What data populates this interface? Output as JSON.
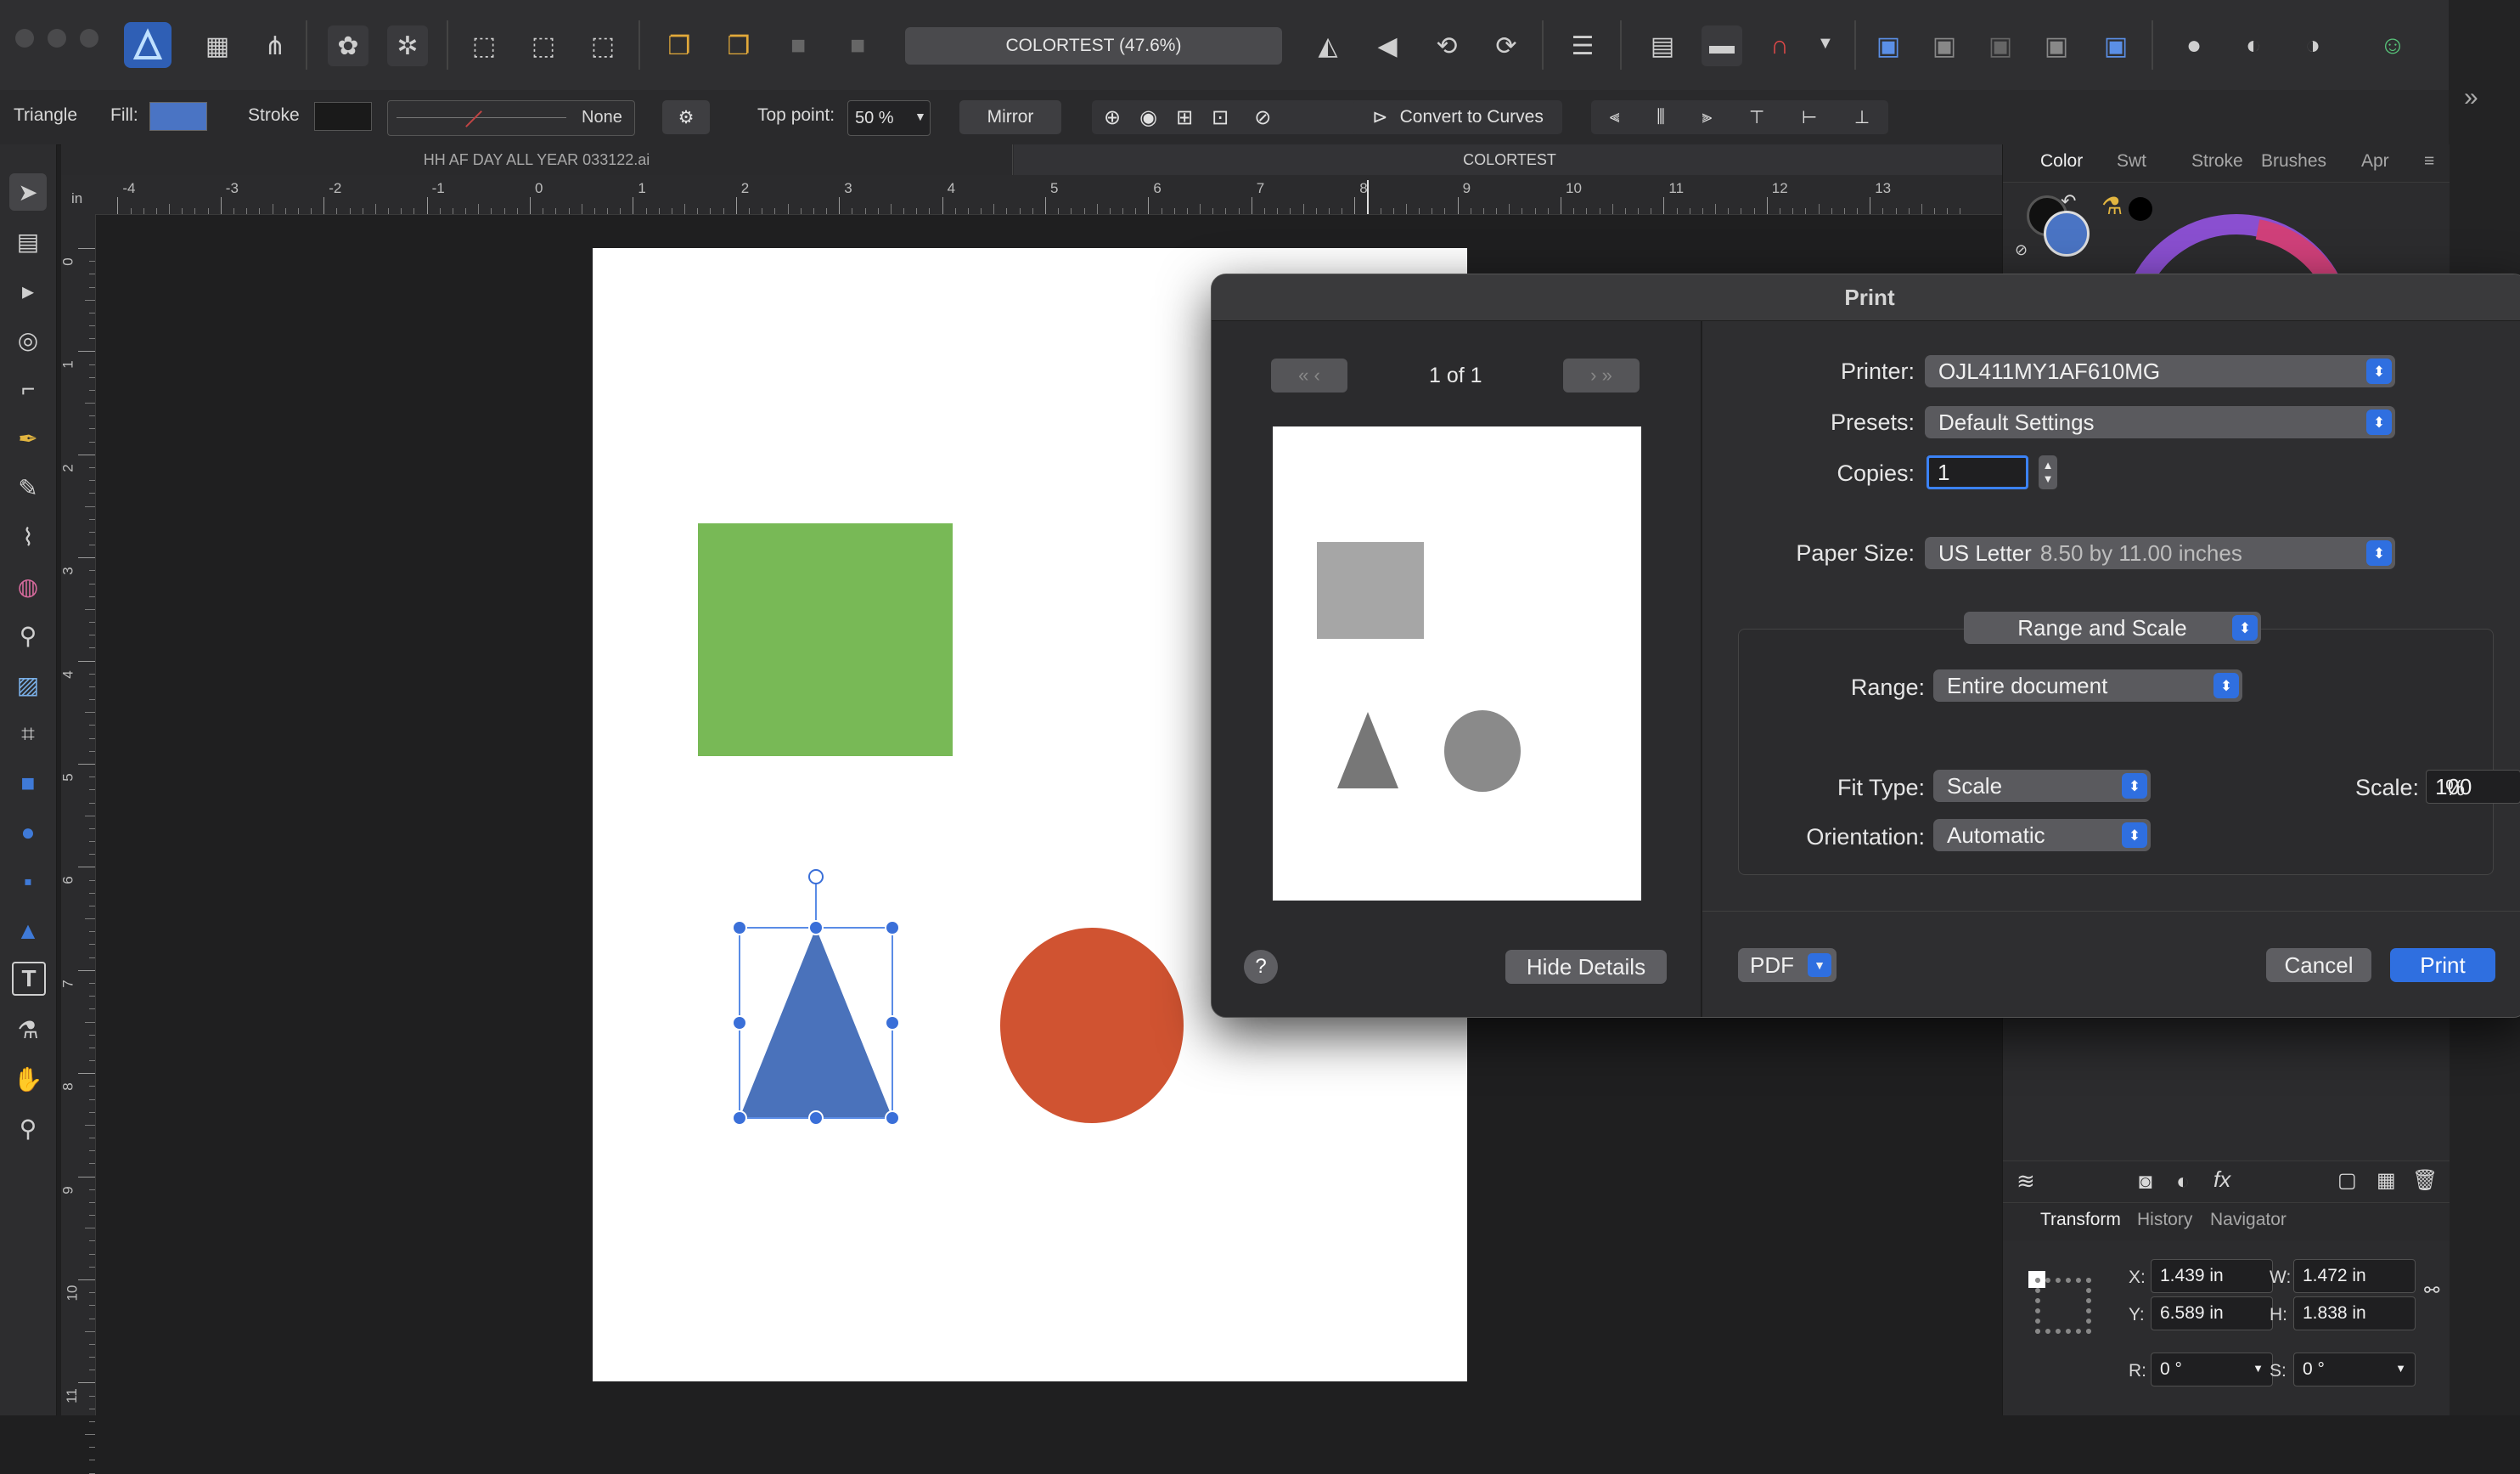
{
  "app": {
    "document_title_pill": "COLORTEST (47.6%)",
    "tabs": [
      "HH AF DAY ALL YEAR 033122.ai",
      "COLORTEST"
    ]
  },
  "context_toolbar": {
    "shape_name": "Triangle",
    "fill_label": "Fill:",
    "stroke_label": "Stroke",
    "stroke_style": "None",
    "top_point_label": "Top point:",
    "top_point_value": "50 %",
    "mirror_label": "Mirror",
    "convert_label": "Convert to Curves"
  },
  "ruler": {
    "unit": "in",
    "h_labels": [
      "-4",
      "-3",
      "-2",
      "-1",
      "0",
      "1",
      "2",
      "3",
      "4",
      "5",
      "6",
      "7",
      "8",
      "9",
      "10",
      "11",
      "12",
      "13"
    ],
    "v_labels": [
      "0",
      "1",
      "2",
      "3",
      "4",
      "5",
      "6",
      "7",
      "8",
      "9",
      "10",
      "11"
    ]
  },
  "right_panel": {
    "tabs": [
      "Color",
      "Swt",
      "Stroke",
      "Brushes",
      "Apr"
    ],
    "bottom_tabs": [
      "Transform",
      "History",
      "Navigator"
    ],
    "transform": {
      "x_label": "X:",
      "x": "1.439 in",
      "y_label": "Y:",
      "y": "6.589 in",
      "w_label": "W:",
      "w": "1.472 in",
      "h_label": "H:",
      "h": "1.838 in",
      "r_label": "R:",
      "r": "0 °",
      "s_label": "S:",
      "s": "0 °"
    }
  },
  "print_dialog": {
    "title": "Print",
    "page_counter": "1 of 1",
    "printer_label": "Printer:",
    "printer": "OJL411MY1AF610MG",
    "presets_label": "Presets:",
    "presets": "Default Settings",
    "copies_label": "Copies:",
    "copies": "1",
    "paper_size_label": "Paper Size:",
    "paper_size": "US Letter",
    "paper_size_detail": "8.50 by 11.00 inches",
    "section": "Range and Scale",
    "range_label": "Range:",
    "range": "Entire document",
    "fit_type_label": "Fit Type:",
    "fit_type": "Scale",
    "scale_label": "Scale:",
    "scale": "100",
    "scale_unit": "%",
    "orientation_label": "Orientation:",
    "orientation": "Automatic",
    "help": "?",
    "hide_details": "Hide Details",
    "pdf": "PDF",
    "cancel": "Cancel",
    "print": "Print"
  },
  "colors": {
    "fill": "#4a74c4",
    "green": "#78b956",
    "red": "#d05331",
    "blue": "#4a72bb",
    "accent": "#2f6fe0"
  }
}
